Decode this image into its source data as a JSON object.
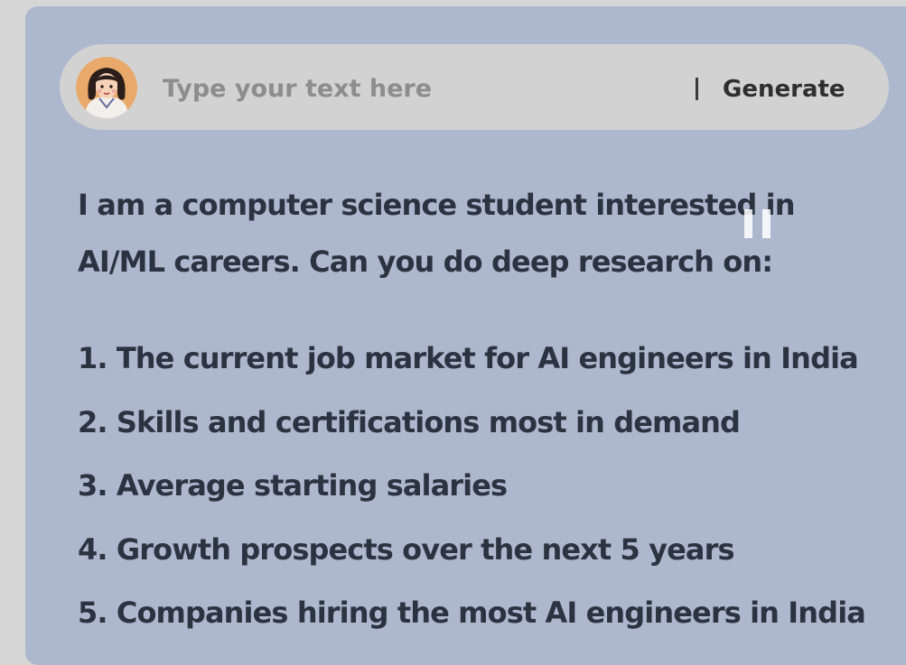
{
  "composer": {
    "avatar_icon": "girl-avatar-icon",
    "input_value": "",
    "input_placeholder": "Type your text here",
    "divider": "|",
    "generate_label": "Generate"
  },
  "prompt": {
    "intro_lines": [
      "I am a computer science student interested in",
      "AI/ML careers. Can you do deep research on:"
    ],
    "items": [
      "1. The current job market for AI engineers in India",
      "2. Skills and certifications most in demand",
      "3. Average starting salaries",
      "4. Growth prospects over the next 5 years",
      "5. Companies hiring the most AI engineers in India"
    ]
  },
  "overlay": {
    "pause_icon": "pause-icon"
  },
  "colors": {
    "panel_background": "#adb8cf",
    "input_background": "#d2d2d2",
    "text": "#2c3340"
  }
}
